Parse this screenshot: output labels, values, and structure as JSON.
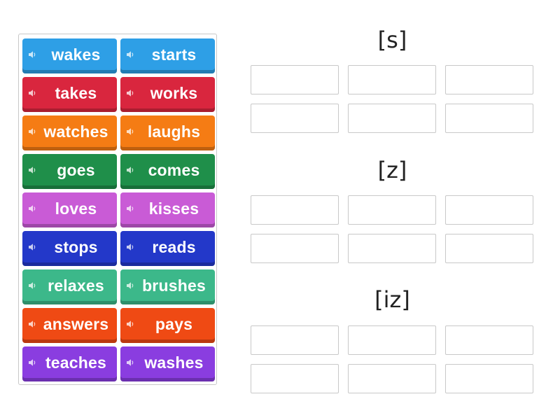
{
  "tiles": [
    {
      "label": "wakes",
      "color": "#2e9fe6"
    },
    {
      "label": "starts",
      "color": "#2e9fe6"
    },
    {
      "label": "takes",
      "color": "#d9263e"
    },
    {
      "label": "works",
      "color": "#d9263e"
    },
    {
      "label": "watches",
      "color": "#f57c14"
    },
    {
      "label": "laughs",
      "color": "#f57c14"
    },
    {
      "label": "goes",
      "color": "#1f8f4a"
    },
    {
      "label": "comes",
      "color": "#1f8f4a"
    },
    {
      "label": "loves",
      "color": "#c95bd6"
    },
    {
      "label": "kisses",
      "color": "#c95bd6"
    },
    {
      "label": "stops",
      "color": "#2338c9"
    },
    {
      "label": "reads",
      "color": "#2338c9"
    },
    {
      "label": "relaxes",
      "color": "#3cb88a"
    },
    {
      "label": "brushes",
      "color": "#3cb88a"
    },
    {
      "label": "answers",
      "color": "#ef4a14"
    },
    {
      "label": "pays",
      "color": "#ef4a14"
    },
    {
      "label": "teaches",
      "color": "#8a3de0"
    },
    {
      "label": "washes",
      "color": "#8a3de0"
    }
  ],
  "groups": [
    {
      "title": "[s]",
      "slot_count": 6
    },
    {
      "title": "[z]",
      "slot_count": 6
    },
    {
      "title": "[iz]",
      "slot_count": 6
    }
  ],
  "icons": {
    "tile_icon": "speaker-icon"
  }
}
